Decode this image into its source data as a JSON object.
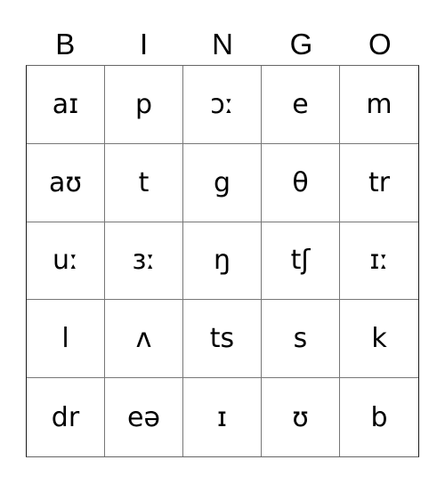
{
  "header": [
    "B",
    "I",
    "N",
    "G",
    "O"
  ],
  "rows": [
    [
      "aɪ",
      "p",
      "ɔː",
      "e",
      "m"
    ],
    [
      "aʊ",
      "t",
      "g",
      "θ",
      "tr"
    ],
    [
      "uː",
      "ɜː",
      "ŋ",
      "tʃ",
      "ɪː"
    ],
    [
      "l",
      "ʌ",
      "ts",
      "s",
      "k"
    ],
    [
      "dr",
      "eə",
      "ɪ",
      "ʊ",
      "b"
    ]
  ]
}
